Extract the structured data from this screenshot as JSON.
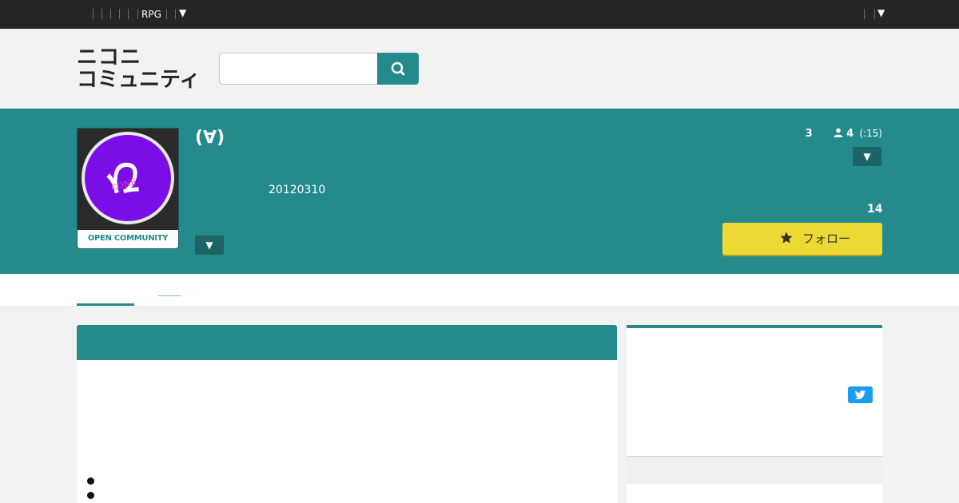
{
  "topbar": {
    "game_label": "RPG",
    "menu_arrow": "▼",
    "right_arrow": "▼"
  },
  "header": {
    "logo_line1": "ニコニ",
    "logo_line2": "コミュニティ",
    "search": {
      "value": "",
      "placeholder": ""
    },
    "search_icon": "search-icon"
  },
  "community": {
    "title": "(∀)",
    "thumbnail_caption": "OPEN COMMUNITY",
    "date": "20120310",
    "level": "3",
    "members": "4",
    "members_sub": "(:15)",
    "follower_count": "14",
    "follow_label": "フォロー",
    "dropdown_arrow": "▼"
  },
  "tabs": {
    "second_label": "＿＿"
  },
  "colors": {
    "accent": "#258a8c",
    "topbar": "#252525",
    "follow_button": "#ecd933",
    "twitter": "#1d9bf0"
  },
  "icons": [
    "search-icon",
    "user-icon",
    "star-icon",
    "twitter-icon"
  ]
}
